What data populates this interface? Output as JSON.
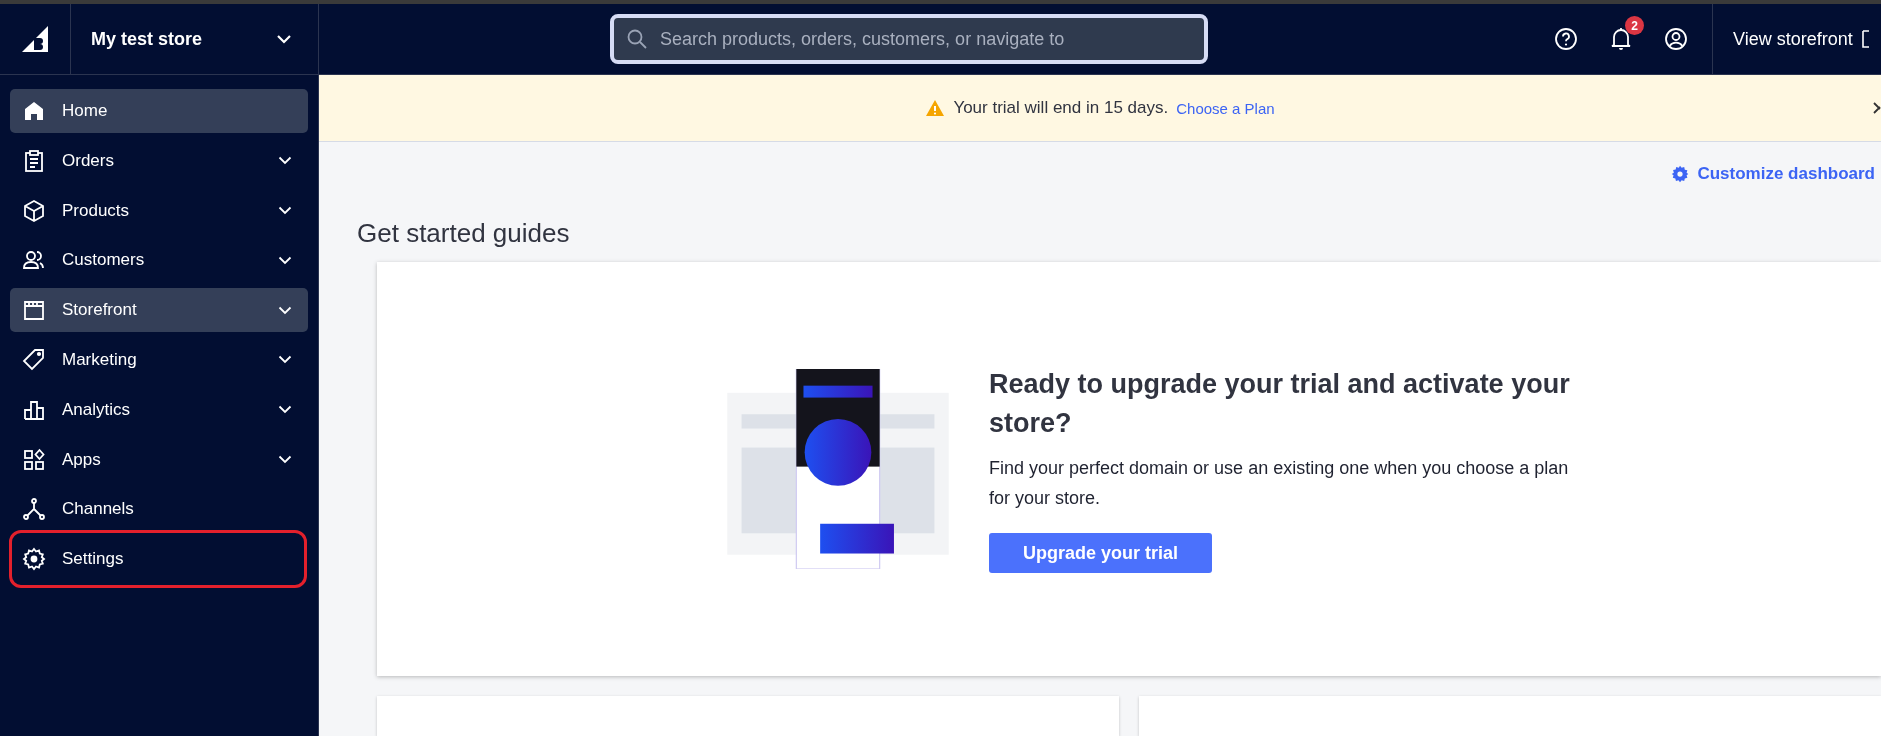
{
  "header": {
    "store_name": "My test store",
    "search": {
      "placeholder": "Search products, orders, customers, or navigate to"
    },
    "notification_count": "2",
    "view_storefront": "View storefront"
  },
  "sidebar": {
    "items": [
      {
        "label": "Home",
        "selected": true,
        "expandable": false,
        "annotated": false
      },
      {
        "label": "Orders",
        "selected": false,
        "expandable": true,
        "annotated": false
      },
      {
        "label": "Products",
        "selected": false,
        "expandable": true,
        "annotated": false
      },
      {
        "label": "Customers",
        "selected": false,
        "expandable": true,
        "annotated": false
      },
      {
        "label": "Storefront",
        "selected": true,
        "expandable": true,
        "annotated": false
      },
      {
        "label": "Marketing",
        "selected": false,
        "expandable": true,
        "annotated": false
      },
      {
        "label": "Analytics",
        "selected": false,
        "expandable": true,
        "annotated": false
      },
      {
        "label": "Apps",
        "selected": false,
        "expandable": true,
        "annotated": false
      },
      {
        "label": "Channels",
        "selected": false,
        "expandable": false,
        "annotated": false
      },
      {
        "label": "Settings",
        "selected": false,
        "expandable": false,
        "annotated": true
      }
    ]
  },
  "banner": {
    "message": "Your trial will end in 15 days.",
    "link": "Choose a Plan"
  },
  "customize_link": "Customize dashboard",
  "section_title": "Get started guides",
  "upgrade_card": {
    "title": "Ready to upgrade your trial and activate your store?",
    "description": "Find your perfect domain or use an existing one when you choose a plan for your store.",
    "button": "Upgrade your trial"
  }
}
